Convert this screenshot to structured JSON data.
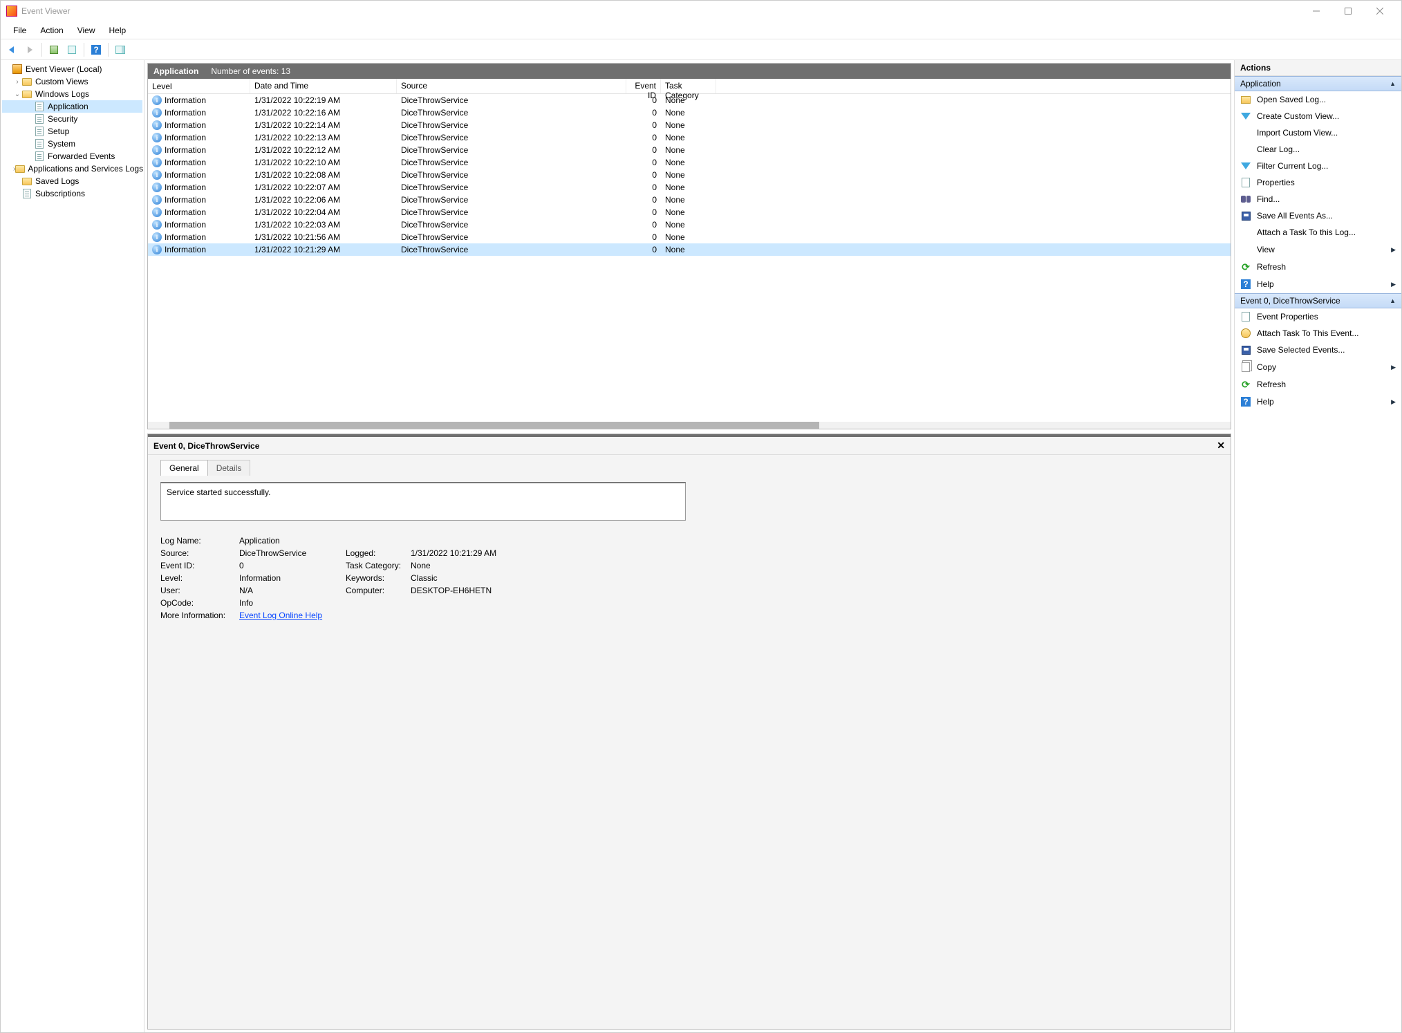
{
  "window": {
    "title": "Event Viewer"
  },
  "menu": {
    "file": "File",
    "action": "Action",
    "view": "View",
    "help": "Help"
  },
  "tree": {
    "root": "Event Viewer (Local)",
    "custom_views": "Custom Views",
    "windows_logs": "Windows Logs",
    "application": "Application",
    "security": "Security",
    "setup": "Setup",
    "system": "System",
    "forwarded": "Forwarded Events",
    "app_services": "Applications and Services Logs",
    "saved_logs": "Saved Logs",
    "subscriptions": "Subscriptions"
  },
  "grid": {
    "band_title": "Application",
    "band_count": "Number of events: 13",
    "columns": {
      "level": "Level",
      "datetime": "Date and Time",
      "source": "Source",
      "eventid": "Event ID",
      "taskcat": "Task Category"
    },
    "rows": [
      {
        "level": "Information",
        "dt": "1/31/2022 10:22:19 AM",
        "source": "DiceThrowService",
        "id": "0",
        "cat": "None"
      },
      {
        "level": "Information",
        "dt": "1/31/2022 10:22:16 AM",
        "source": "DiceThrowService",
        "id": "0",
        "cat": "None"
      },
      {
        "level": "Information",
        "dt": "1/31/2022 10:22:14 AM",
        "source": "DiceThrowService",
        "id": "0",
        "cat": "None"
      },
      {
        "level": "Information",
        "dt": "1/31/2022 10:22:13 AM",
        "source": "DiceThrowService",
        "id": "0",
        "cat": "None"
      },
      {
        "level": "Information",
        "dt": "1/31/2022 10:22:12 AM",
        "source": "DiceThrowService",
        "id": "0",
        "cat": "None"
      },
      {
        "level": "Information",
        "dt": "1/31/2022 10:22:10 AM",
        "source": "DiceThrowService",
        "id": "0",
        "cat": "None"
      },
      {
        "level": "Information",
        "dt": "1/31/2022 10:22:08 AM",
        "source": "DiceThrowService",
        "id": "0",
        "cat": "None"
      },
      {
        "level": "Information",
        "dt": "1/31/2022 10:22:07 AM",
        "source": "DiceThrowService",
        "id": "0",
        "cat": "None"
      },
      {
        "level": "Information",
        "dt": "1/31/2022 10:22:06 AM",
        "source": "DiceThrowService",
        "id": "0",
        "cat": "None"
      },
      {
        "level": "Information",
        "dt": "1/31/2022 10:22:04 AM",
        "source": "DiceThrowService",
        "id": "0",
        "cat": "None"
      },
      {
        "level": "Information",
        "dt": "1/31/2022 10:22:03 AM",
        "source": "DiceThrowService",
        "id": "0",
        "cat": "None"
      },
      {
        "level": "Information",
        "dt": "1/31/2022 10:21:56 AM",
        "source": "DiceThrowService",
        "id": "0",
        "cat": "None"
      },
      {
        "level": "Information",
        "dt": "1/31/2022 10:21:29 AM",
        "source": "DiceThrowService",
        "id": "0",
        "cat": "None"
      }
    ],
    "selected_index": 12
  },
  "details": {
    "title": "Event 0, DiceThrowService",
    "tabs": {
      "general": "General",
      "details": "Details"
    },
    "message": "Service started successfully.",
    "labels": {
      "log_name": "Log Name:",
      "source": "Source:",
      "event_id": "Event ID:",
      "level": "Level:",
      "user": "User:",
      "opcode": "OpCode:",
      "more_info": "More Information:",
      "logged": "Logged:",
      "task_cat": "Task Category:",
      "keywords": "Keywords:",
      "computer": "Computer:"
    },
    "values": {
      "log_name": "Application",
      "source": "DiceThrowService",
      "event_id": "0",
      "level": "Information",
      "user": "N/A",
      "opcode": "Info",
      "more_info": "Event Log Online Help",
      "logged": "1/31/2022 10:21:29 AM",
      "task_cat": "None",
      "keywords": "Classic",
      "computer": "DESKTOP-EH6HETN"
    }
  },
  "actions": {
    "title": "Actions",
    "group1_head": "Application",
    "group1": {
      "open_saved": "Open Saved Log...",
      "create_custom": "Create Custom View...",
      "import_custom": "Import Custom View...",
      "clear_log": "Clear Log...",
      "filter_log": "Filter Current Log...",
      "properties": "Properties",
      "find": "Find...",
      "save_all": "Save All Events As...",
      "attach_task": "Attach a Task To this Log...",
      "view": "View",
      "refresh": "Refresh",
      "help": "Help"
    },
    "group2_head": "Event 0, DiceThrowService",
    "group2": {
      "event_props": "Event Properties",
      "attach_task_event": "Attach Task To This Event...",
      "save_selected": "Save Selected Events...",
      "copy": "Copy",
      "refresh": "Refresh",
      "help": "Help"
    }
  }
}
